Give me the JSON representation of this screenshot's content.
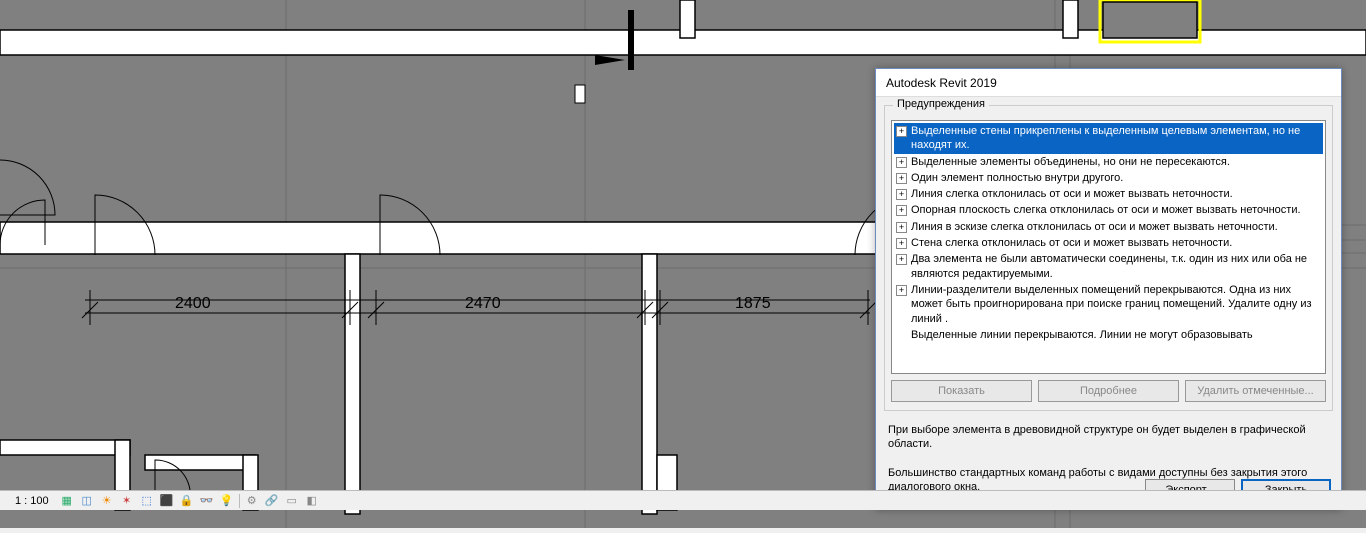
{
  "dialog": {
    "title": "Autodesk Revit 2019",
    "group_label": "Предупреждения",
    "warnings": [
      "Выделенные стены прикреплены к выделенным целевым элементам, но не находят их.",
      "Выделенные элементы объединены, но они не пересекаются.",
      "Один элемент полностью внутри другого.",
      "Линия слегка отклонилась от оси и может вызвать неточности.",
      "Опорная плоскость слегка отклонилась от оси и может вызвать неточности.",
      "Линия в эскизе слегка отклонилась от оси и может вызвать неточности.",
      "Стена слегка отклонилась от оси и может вызвать неточности.",
      "Два элемента не были автоматически соединены, т.к. один из них или оба не являются редактируемыми.",
      "Линии-разделители выделенных помещений перекрываются. Одна из них может быть проигнорирована при поиске границ помещений. Удалите одну из линий .",
      "Выделенные линии перекрываются. Линии не могут образовывать"
    ],
    "btn_show": "Показать",
    "btn_more": "Подробнее",
    "btn_delete": "Удалить отмеченные...",
    "info1": "При выборе элемента в древовидной структуре он будет выделен в графической области.",
    "info2": "Большинство стандартных команд работы с видами доступны без закрытия этого диалогового окна.",
    "btn_export": "Экспорт...",
    "btn_close": "Закрыть"
  },
  "dims": {
    "d1": "2400",
    "d2": "2470",
    "d3": "1875"
  },
  "status": {
    "scale": "1 : 100"
  }
}
